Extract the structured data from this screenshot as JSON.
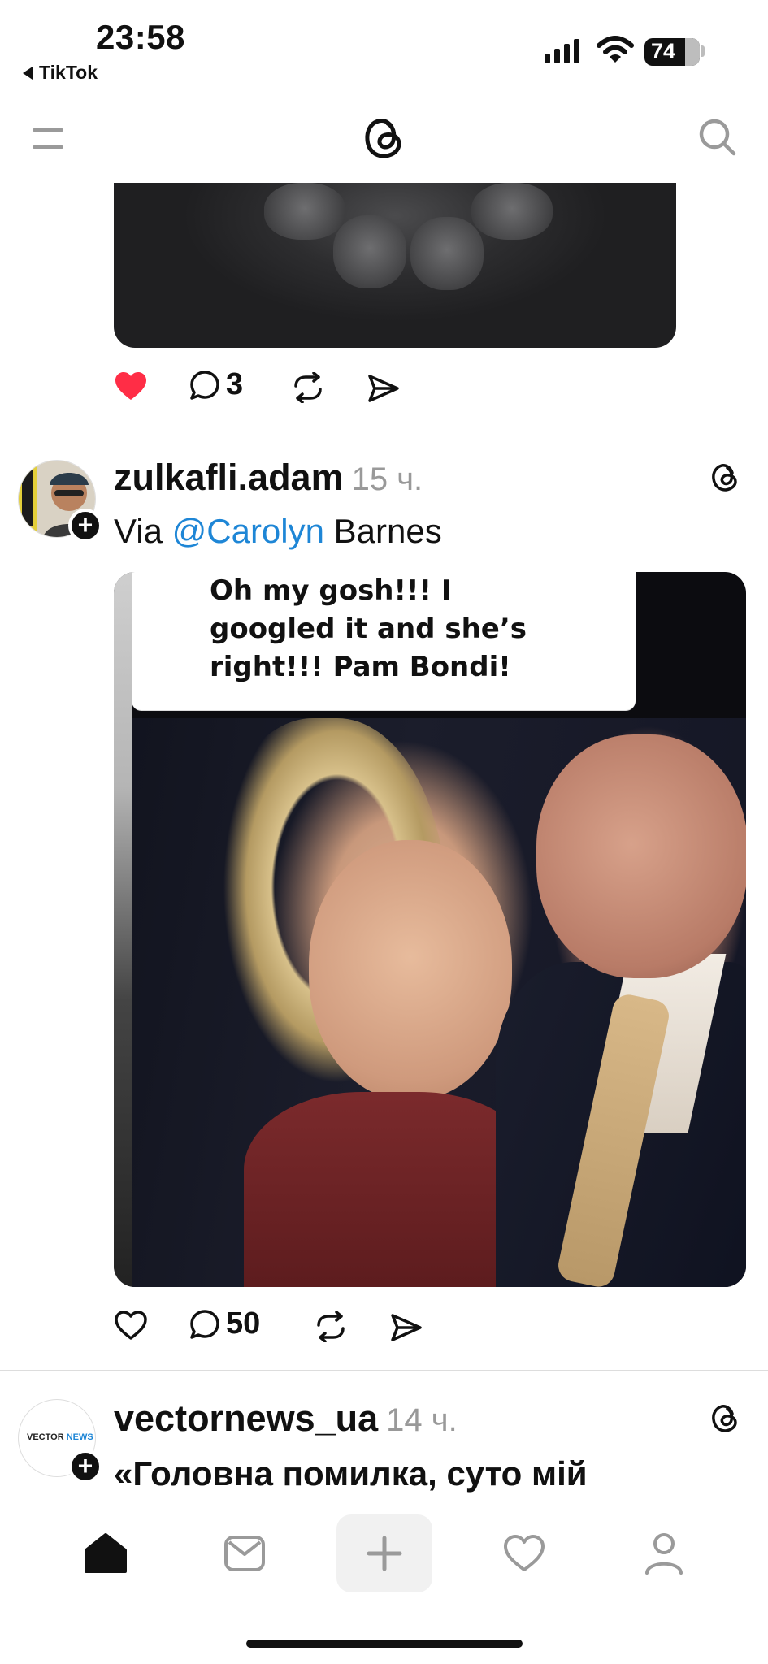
{
  "status_bar": {
    "time": "23:58",
    "back_app": "TikTok",
    "battery": "74"
  },
  "header": {
    "menu_icon": "menu-icon",
    "logo_icon": "threads-logo-icon",
    "search_icon": "search-icon"
  },
  "posts": [
    {
      "image": "cat photo (partial)",
      "liked": true,
      "replies": "3"
    },
    {
      "username": "zulkafli.adam",
      "ago": "15 ч.",
      "text_prefix": "Via ",
      "mention": "@Carolyn",
      "text_suffix": " Barnes",
      "image_caption": "Oh my gosh!!! I\ngoogled it and she’s\nright!!! Pam Bondi!",
      "liked": false,
      "replies": "50"
    },
    {
      "username": "vectornews_ua",
      "ago": "14 ч.",
      "text": "«Головна помилка, суто мій",
      "avatar_logo": "VECTOR",
      "avatar_logo_accent": "NEWS"
    }
  ],
  "colors": {
    "like_red": "#ff2d46",
    "mention_blue": "#1e86d6",
    "muted_gray": "#999999"
  },
  "bottom_nav": [
    "home-icon",
    "inbox-icon",
    "create-icon",
    "activity-heart-icon",
    "profile-icon"
  ]
}
